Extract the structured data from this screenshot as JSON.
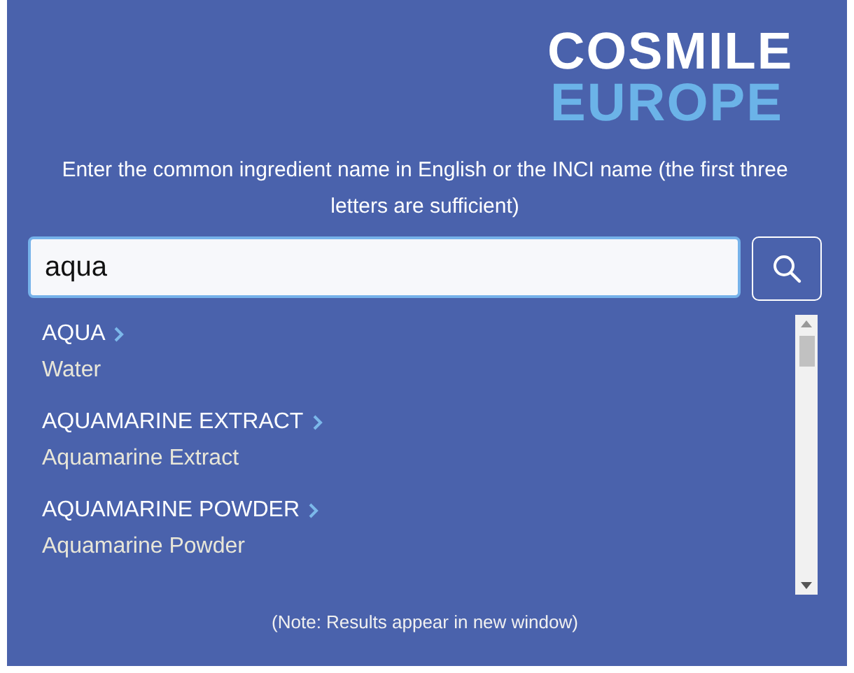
{
  "logo": {
    "line_1": "COSMILE",
    "line_2": "EUROPE"
  },
  "instructions": "Enter the common ingredient name in English or the INCI name (the first three letters are sufficient)",
  "search": {
    "value": "aqua"
  },
  "results": [
    {
      "inci": "AQUA",
      "common": "Water"
    },
    {
      "inci": "AQUAMARINE EXTRACT",
      "common": "Aquamarine Extract"
    },
    {
      "inci": "AQUAMARINE POWDER",
      "common": "Aquamarine Powder"
    }
  ],
  "note": "(Note: Results appear in new window)"
}
